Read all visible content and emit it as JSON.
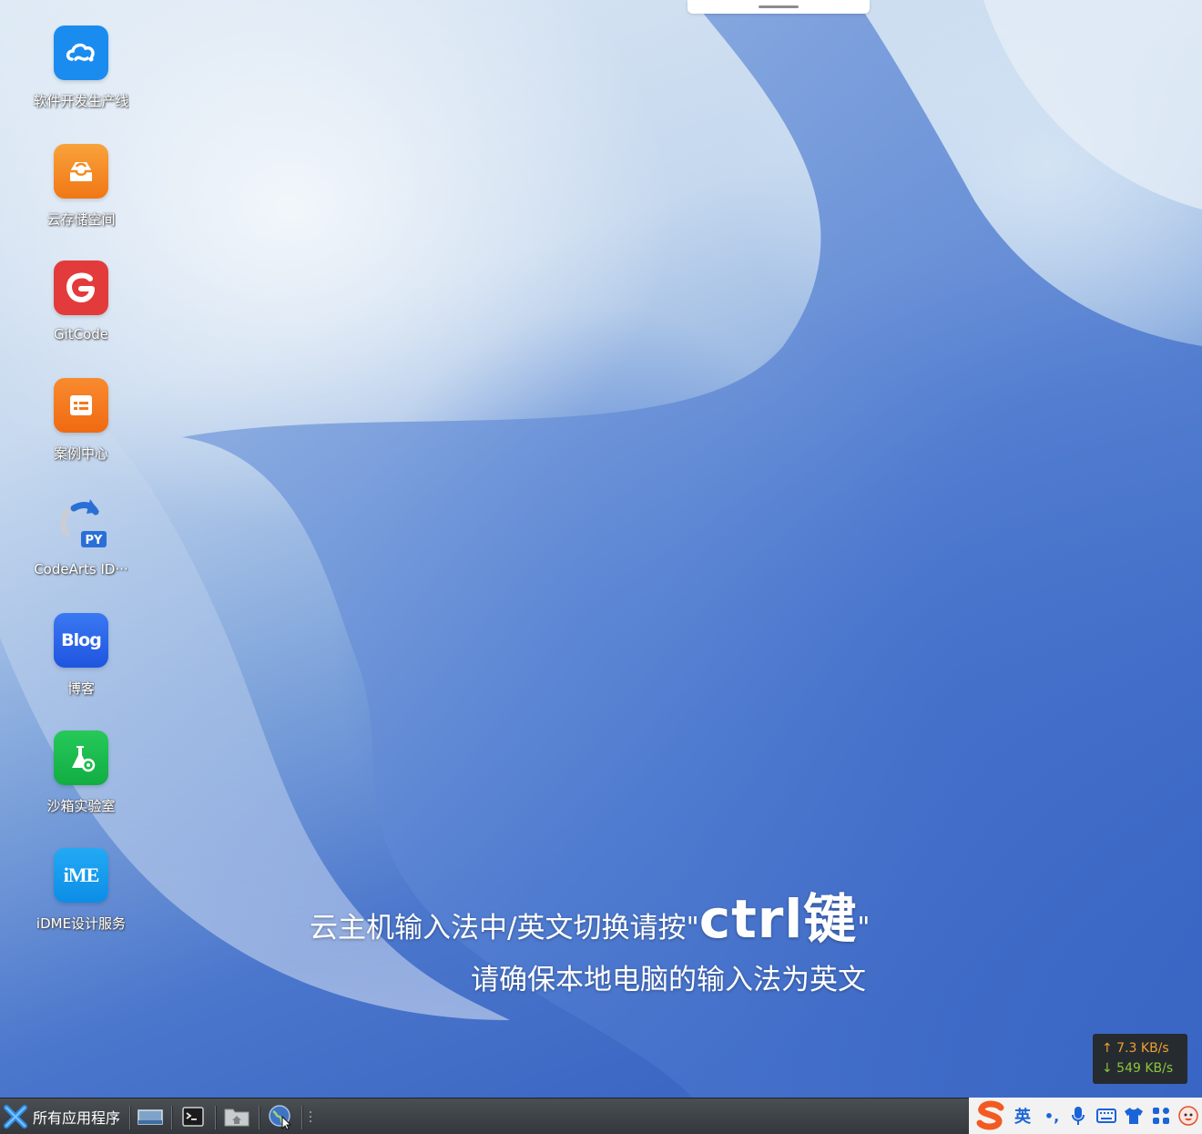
{
  "desktop": {
    "icons": [
      {
        "label": "软件开发生产线",
        "icon": "cloud-devops-icon",
        "color": "#1a8cf0"
      },
      {
        "label": "云存储空间",
        "icon": "cloud-storage-icon",
        "color": "#f5891f"
      },
      {
        "label": "GitCode",
        "icon": "gitcode-icon",
        "color": "#e33b3b"
      },
      {
        "label": "案例中心",
        "icon": "case-center-icon",
        "color": "#f37a1e"
      },
      {
        "label": "CodeArts ID···",
        "icon": "codearts-ide-python-icon",
        "badge": "PY",
        "color": "#2a6fd6"
      },
      {
        "label": "博客",
        "icon": "blog-icon",
        "badge": "Blog",
        "color": "#2663e8"
      },
      {
        "label": "沙箱实验室",
        "icon": "sandbox-lab-icon",
        "color": "#1ebd4e"
      },
      {
        "label": "iDME设计服务",
        "icon": "idme-icon",
        "badge": "iME",
        "color": "#149bf0"
      }
    ]
  },
  "notice": {
    "line1_prefix": "云主机输入法中/英文切换请按\"",
    "line1_key": "ctrl键",
    "line1_suffix": "\"",
    "line2": "请确保本地电脑的输入法为英文"
  },
  "netspeed": {
    "upload": "↑ 7.3 KB/s",
    "download": "↓ 549 KB/s"
  },
  "taskbar": {
    "start_label": "所有应用程序",
    "tray": {
      "ime_mode": "英",
      "punct": "•,"
    }
  }
}
